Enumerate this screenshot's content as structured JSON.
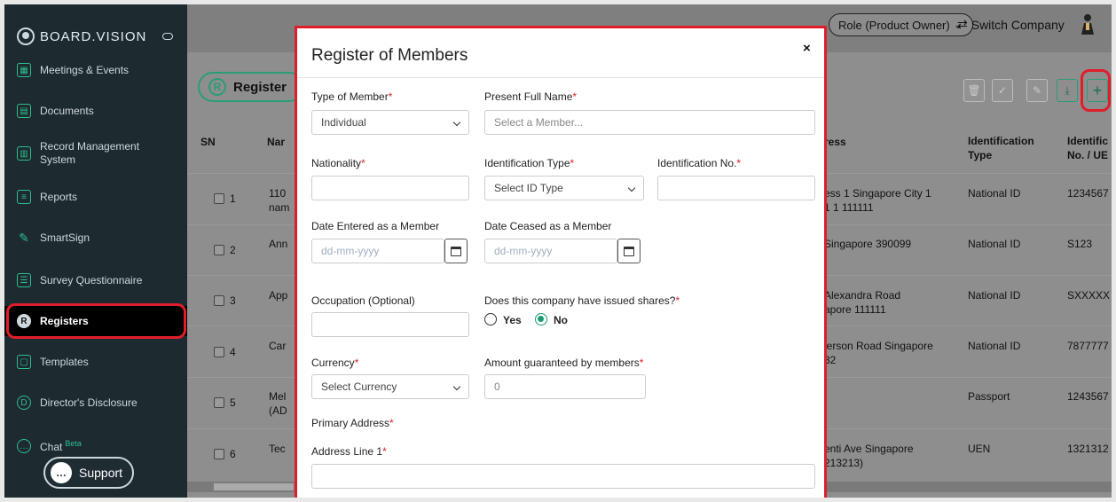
{
  "sidebar": {
    "brand": "BOARD.VISION",
    "items": [
      {
        "label": "Meetings & Events",
        "icon": "calendar-icon"
      },
      {
        "label": "Documents",
        "icon": "documents-icon"
      },
      {
        "label": "Record Management System",
        "icon": "record-icon"
      },
      {
        "label": "Reports",
        "icon": "reports-icon"
      },
      {
        "label": "SmartSign",
        "icon": "pen-icon"
      },
      {
        "label": "Survey Questionnaire",
        "icon": "survey-icon"
      },
      {
        "label": "Registers",
        "icon": "registers-icon"
      },
      {
        "label": "Templates",
        "icon": "templates-icon"
      },
      {
        "label": "Director's Disclosure",
        "icon": "disclosure-icon"
      },
      {
        "label": "Chat",
        "icon": "chat-icon",
        "badge": "Beta"
      }
    ],
    "support_label": "Support"
  },
  "header": {
    "role_label": "Role (Product Owner)",
    "switch_label": "Switch Company"
  },
  "registers_pill": "Register",
  "table": {
    "headers": [
      "SN",
      "Nar",
      "ress",
      "Identification Type",
      "Identific No. / UE"
    ],
    "rows": [
      {
        "sn": "1",
        "name": "110\nnam",
        "address": "ess 1 Singapore City 1\n1 1 111111",
        "id_type": "National ID",
        "id_no": "1234567"
      },
      {
        "sn": "2",
        "name": "Ann",
        "address": "Singapore 390099",
        "id_type": "National ID",
        "id_no": "S123"
      },
      {
        "sn": "3",
        "name": "App",
        "address": "Alexandra Road\napore 111111",
        "id_type": "National ID",
        "id_no": "SXXXXX"
      },
      {
        "sn": "4",
        "name": "Car",
        "address": "lerson Road Singapore\n32",
        "id_type": "National ID",
        "id_no": "7877777"
      },
      {
        "sn": "5",
        "name": "Mel\n(AD",
        "address": "",
        "id_type": "Passport",
        "id_no": "1243567"
      },
      {
        "sn": "6",
        "name": "Tec",
        "address": "enti Ave Singapore\n213213)",
        "id_type": "UEN",
        "id_no": "1321312"
      }
    ]
  },
  "modal": {
    "title": "Register of Members",
    "close": "×",
    "type_of_member": {
      "label": "Type of Member",
      "value": "Individual"
    },
    "present_full_name": {
      "label": "Present Full Name",
      "placeholder": "Select a Member..."
    },
    "nationality": {
      "label": "Nationality",
      "value": ""
    },
    "identification_type": {
      "label": "Identification Type",
      "value": "Select ID Type"
    },
    "identification_no": {
      "label": "Identification No.",
      "value": ""
    },
    "date_entered": {
      "label": "Date Entered as a Member",
      "placeholder": "dd-mm-yyyy"
    },
    "date_ceased": {
      "label": "Date Ceased as a Member",
      "placeholder": "dd-mm-yyyy"
    },
    "occupation": {
      "label": "Occupation (Optional)",
      "value": ""
    },
    "issued_shares": {
      "label": "Does this company have issued shares?",
      "options": [
        "Yes",
        "No"
      ],
      "selected": "No"
    },
    "currency": {
      "label": "Currency",
      "value": "Select Currency"
    },
    "amount_guaranteed": {
      "label": "Amount guaranteed by members",
      "value": "0"
    },
    "primary_address": {
      "label": "Primary Address"
    },
    "address_line_1": {
      "label": "Address Line 1",
      "value": ""
    },
    "required_mark": "*"
  },
  "colors": {
    "accent": "#1a9c73",
    "highlight": "#e01e2b",
    "sidebar_bg": "#1d2a30"
  }
}
